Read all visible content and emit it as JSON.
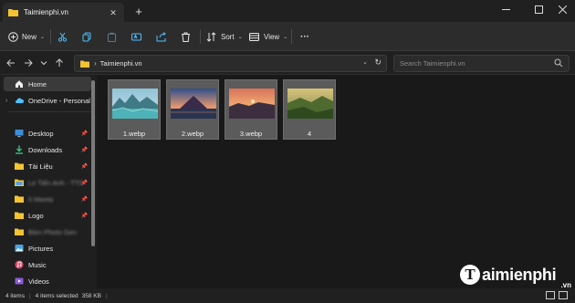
{
  "window": {
    "tab_title": "Taimienphi.vn",
    "new_tab_label": "+",
    "close_tab_label": "✕"
  },
  "toolbar": {
    "new_label": "New",
    "sort_label": "Sort",
    "view_label": "View",
    "more_label": "···"
  },
  "address": {
    "path": "Taimienphi.vn",
    "search_placeholder": "Search Taimienphi.vn"
  },
  "sidebar": {
    "items": [
      {
        "label": "Home",
        "icon": "home-icon"
      },
      {
        "label": "OneDrive - Personal",
        "icon": "cloud-icon"
      },
      {
        "label": "Desktop",
        "icon": "desktop-icon"
      },
      {
        "label": "Downloads",
        "icon": "download-icon"
      },
      {
        "label": "Tài Liệu",
        "icon": "folder-icon"
      },
      {
        "label": "Le Tiến Anh - TTS",
        "icon": "folder-icon"
      },
      {
        "label": "0 Meeta",
        "icon": "folder-icon"
      },
      {
        "label": "Logo",
        "icon": "folder-icon"
      },
      {
        "label": "Bien Photo Gen",
        "icon": "folder-icon"
      },
      {
        "label": "Pictures",
        "icon": "pictures-icon"
      },
      {
        "label": "Music",
        "icon": "music-icon"
      },
      {
        "label": "Videos",
        "icon": "videos-icon"
      }
    ]
  },
  "files": [
    {
      "name": "1.webp"
    },
    {
      "name": "2.webp"
    },
    {
      "name": "3.webp"
    },
    {
      "name": "4"
    }
  ],
  "status": {
    "item_count": "4 items",
    "selection": "4 items selected",
    "size": "358 KB"
  },
  "watermark": {
    "logo_letter": "T",
    "text": "aimienphi",
    "suffix": ".vn"
  },
  "colors": {
    "accent": "#4cc2ff",
    "folder": "#f4c430",
    "background": "#191919"
  }
}
